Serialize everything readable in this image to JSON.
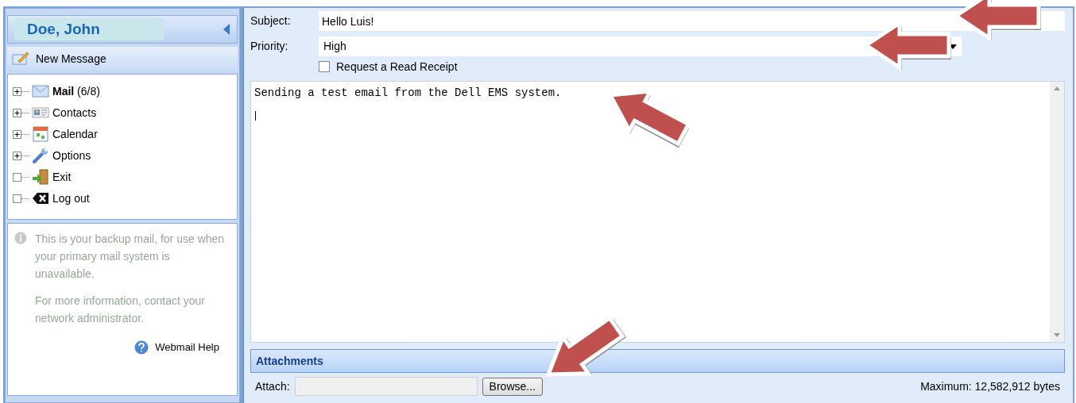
{
  "sidebar": {
    "user_name": "Doe, John",
    "new_message": "New Message",
    "tree": [
      {
        "label": "Mail",
        "count": "(6/8)",
        "kind": "branch"
      },
      {
        "label": "Contacts",
        "kind": "branch"
      },
      {
        "label": "Calendar",
        "kind": "branch"
      },
      {
        "label": "Options",
        "kind": "branch"
      },
      {
        "label": "Exit",
        "kind": "leaf"
      },
      {
        "label": "Log out",
        "kind": "leaf"
      }
    ],
    "info": [
      "This is your backup mail, for use when your primary mail system is unavailable.",
      "For more information, contact your network administrator."
    ],
    "help_link": "Webmail Help"
  },
  "compose": {
    "subject_label": "Subject:",
    "subject": "Hello Luis!",
    "priority_label": "Priority:",
    "priority": "High",
    "read_receipt": {
      "label": "Request a Read Receipt",
      "checked": false
    },
    "body": "Sending a test email from the Dell EMS system.",
    "attachments_title": "Attachments",
    "attach_label": "Attach:",
    "browse": "Browse...",
    "maximum": "Maximum: 12,582,912 bytes"
  }
}
